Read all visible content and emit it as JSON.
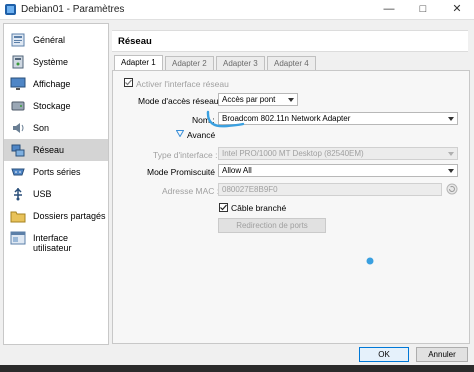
{
  "window": {
    "title": "Debian01 - Paramètres"
  },
  "sidebar": {
    "items": [
      {
        "label": "Général",
        "icon": "general-icon"
      },
      {
        "label": "Système",
        "icon": "system-icon"
      },
      {
        "label": "Affichage",
        "icon": "display-icon"
      },
      {
        "label": "Stockage",
        "icon": "storage-icon"
      },
      {
        "label": "Son",
        "icon": "sound-icon"
      },
      {
        "label": "Réseau",
        "icon": "network-icon",
        "active": true
      },
      {
        "label": "Ports séries",
        "icon": "serial-ports-icon"
      },
      {
        "label": "USB",
        "icon": "usb-icon"
      },
      {
        "label": "Dossiers partagés",
        "icon": "shared-folders-icon"
      },
      {
        "label": "Interface utilisateur",
        "icon": "user-interface-icon"
      }
    ]
  },
  "panel": {
    "title": "Réseau"
  },
  "tabs": [
    "Adapter 1",
    "Adapter 2",
    "Adapter 3",
    "Adapter 4"
  ],
  "adapter": {
    "enable_label": "Activer l'interface réseau",
    "mode_label": "Mode d'accès réseau :",
    "mode_value": "Accès par pont",
    "name_label": "Nom :",
    "name_value": "Broadcom 802.11n Network Adapter",
    "advanced_label": "Avancé",
    "type_label": "Type d'interface :",
    "type_value": "Intel PRO/1000 MT Desktop (82540EM)",
    "promisc_label": "Mode Promiscuité :",
    "promisc_value": "Allow All",
    "mac_label": "Adresse MAC :",
    "mac_value": "080027E8B9F0",
    "cable_label": "Câble branché",
    "port_forwarding_label": "Redirection de ports"
  },
  "footer": {
    "ok_label": "OK",
    "cancel_label": "Annuler"
  },
  "colors": {
    "accent": "#0078d7",
    "annotation": "#3aa0e0"
  }
}
